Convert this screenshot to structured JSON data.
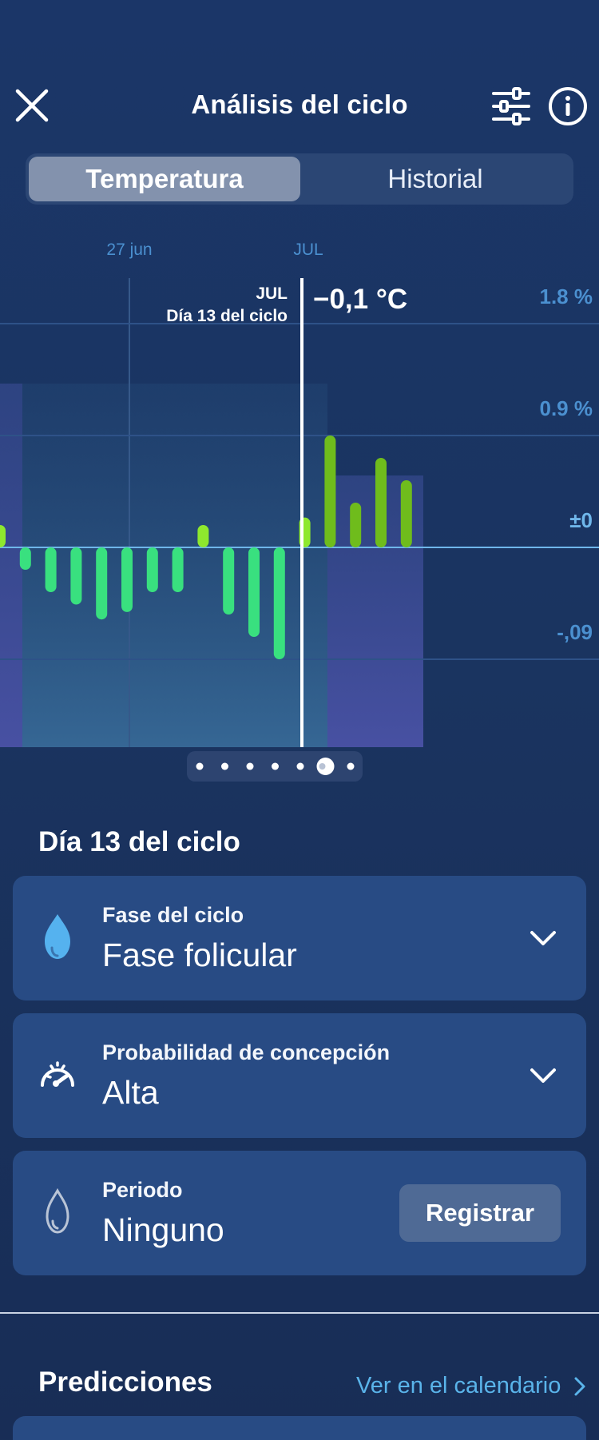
{
  "header": {
    "title": "Análisis del ciclo",
    "close_icon": "close-icon",
    "filter_icon": "sliders-icon",
    "info_icon": "info-icon"
  },
  "tabs": [
    {
      "label": "Temperatura",
      "active": true
    },
    {
      "label": "Historial",
      "active": false
    }
  ],
  "chart_data": {
    "type": "bar",
    "x_axis_labels": [
      "27 jun",
      "JUL"
    ],
    "y_tick_labels": [
      "1.8 %",
      "0.9 %",
      "±0",
      "-,09"
    ],
    "y_ticks": [
      1.8,
      0.9,
      0,
      -0.9
    ],
    "ylim": [
      -1.6,
      1.8
    ],
    "selected": {
      "month": "JUL",
      "day_label": "Día 13 del ciclo",
      "value_label": "−0,1 °C",
      "index": 12
    },
    "values": [
      0.18,
      -0.18,
      -0.36,
      -0.46,
      -0.58,
      -0.52,
      -0.36,
      -0.36,
      0.18,
      -0.54,
      -0.72,
      -0.9,
      0.24,
      0.9,
      0.36,
      0.72,
      0.54
    ],
    "colors": {
      "negative_bar": "#39e07f",
      "positive_bar": "#8ee82e",
      "future_bar": "#6fbc1c",
      "axis_label": "#4b90d0",
      "zero_line": "#6fb6ea"
    }
  },
  "pager": {
    "count": 7,
    "active_index": 5
  },
  "day_section": {
    "title": "Día 13 del ciclo"
  },
  "cards": {
    "phase": {
      "label": "Fase del ciclo",
      "value": "Fase folicular",
      "icon": "drop-icon"
    },
    "conception": {
      "label": "Probabilidad de concepción",
      "value": "Alta",
      "icon": "gauge-icon"
    },
    "period": {
      "label": "Periodo",
      "value": "Ninguno",
      "icon": "period-drop-icon",
      "button_label": "Registrar"
    }
  },
  "predictions": {
    "title": "Predicciones",
    "link_label": "Ver en el calendario"
  }
}
